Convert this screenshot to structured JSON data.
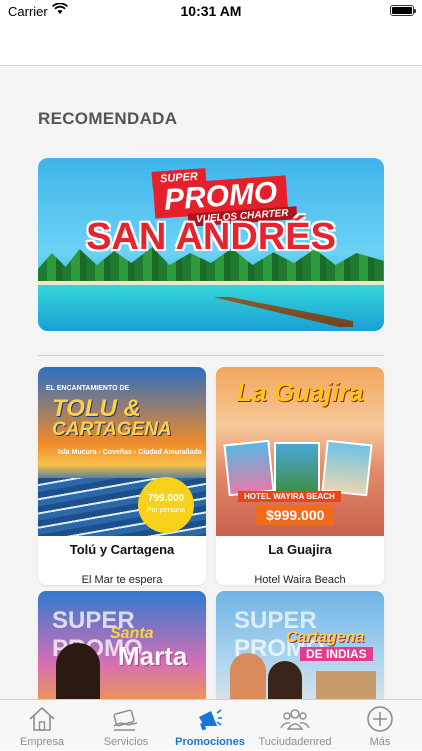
{
  "status_bar": {
    "carrier": "Carrier",
    "time": "10:31 AM",
    "icons": [
      "wifi-icon",
      "battery-icon"
    ]
  },
  "section": {
    "title": "RECOMENDADA"
  },
  "hero": {
    "badge": "SUPER",
    "headline": "PROMO",
    "sub": "VUELOS CHARTER",
    "destination": "SAN ANDRÉS"
  },
  "cards": [
    {
      "title": "Tolú y Cartagena",
      "subtitle": "El Mar te espera",
      "image": {
        "tagline": "EL ENCANTAMIENTO DE",
        "line1": "TOLU &",
        "line2": "CARTAGENA",
        "places": "Isla Mucura - Coveñas - Ciudad Amurallada",
        "price": "799.000",
        "price_note": "Por persona"
      }
    },
    {
      "title": "La Guajira",
      "subtitle": "Hotel Waira Beach",
      "image": {
        "headline": "La Guajira",
        "hotel": "HOTEL WAYIRA BEACH",
        "price": "$999.000"
      }
    },
    {
      "title": "",
      "subtitle": "",
      "image": {
        "watermark": "SUPER PROMO",
        "line1": "Santa",
        "line2": "Marta"
      }
    },
    {
      "title": "",
      "subtitle": "",
      "image": {
        "watermark": "SUPER PROMO",
        "line1": "Cartagena",
        "line2": "DE INDIAS"
      }
    }
  ],
  "tabs": [
    {
      "label": "Empresa",
      "icon": "home-icon",
      "active": false
    },
    {
      "label": "Servicios",
      "icon": "card-icon",
      "active": false
    },
    {
      "label": "Promociones",
      "icon": "megaphone-icon",
      "active": true
    },
    {
      "label": "Tuciudadenred",
      "icon": "people-icon",
      "active": false
    },
    {
      "label": "Más",
      "icon": "plus-circle-icon",
      "active": false
    }
  ],
  "colors": {
    "accent": "#1877d2",
    "tab_inactive": "#8e8e8e",
    "background": "#f4f4f4"
  }
}
